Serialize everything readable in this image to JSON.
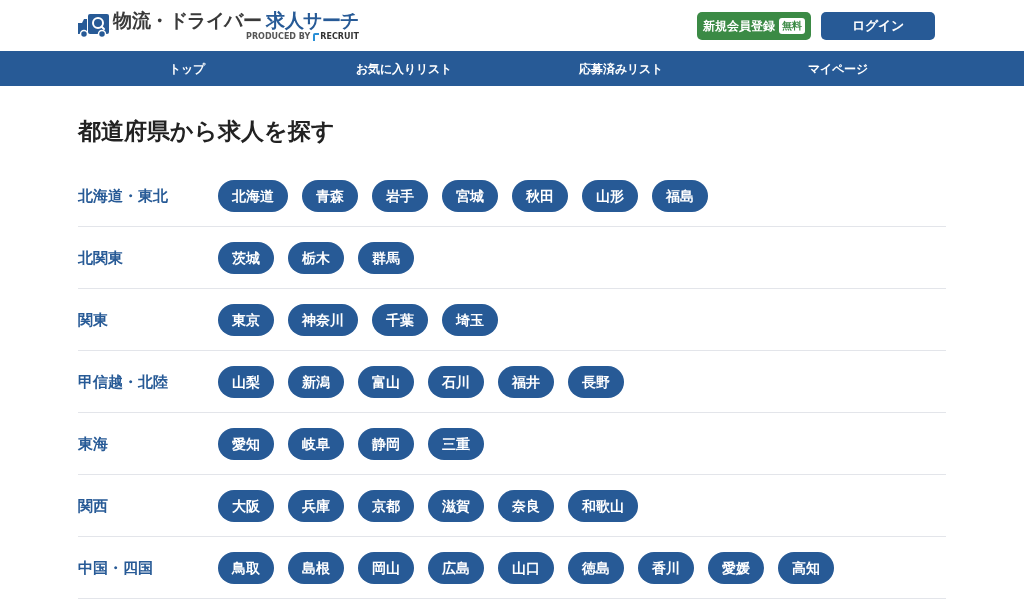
{
  "header": {
    "logo": {
      "title_main": "物流・ドライバー",
      "title_sub": "求人サーチ",
      "produced_by": "PRODUCED BY",
      "brand": "RECRUIT"
    },
    "buttons": [
      {
        "kind": "register",
        "label": "新規会員登録",
        "badge": "無料"
      },
      {
        "kind": "login",
        "label": "ログイン"
      }
    ]
  },
  "nav": {
    "items": [
      "トップ",
      "お気に入りリスト",
      "応募済みリスト",
      "マイページ"
    ]
  },
  "heading": "都道府県から求人を探す",
  "regions": [
    {
      "name": "北海道・東北",
      "prefectures": [
        "北海道",
        "青森",
        "岩手",
        "宮城",
        "秋田",
        "山形",
        "福島"
      ]
    },
    {
      "name": "北関東",
      "prefectures": [
        "茨城",
        "栃木",
        "群馬"
      ]
    },
    {
      "name": "関東",
      "prefectures": [
        "東京",
        "神奈川",
        "千葉",
        "埼玉"
      ]
    },
    {
      "name": "甲信越・北陸",
      "prefectures": [
        "山梨",
        "新潟",
        "富山",
        "石川",
        "福井",
        "長野"
      ]
    },
    {
      "name": "東海",
      "prefectures": [
        "愛知",
        "岐阜",
        "静岡",
        "三重"
      ]
    },
    {
      "name": "関西",
      "prefectures": [
        "大阪",
        "兵庫",
        "京都",
        "滋賀",
        "奈良",
        "和歌山"
      ]
    },
    {
      "name": "中国・四国",
      "prefectures": [
        "鳥取",
        "島根",
        "岡山",
        "広島",
        "山口",
        "徳島",
        "香川",
        "愛媛",
        "高知"
      ]
    }
  ]
}
